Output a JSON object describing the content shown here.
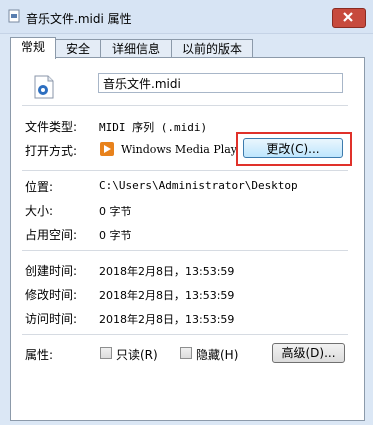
{
  "window": {
    "title": "音乐文件.midi 属性"
  },
  "tabs": [
    {
      "label": "常规",
      "active": true
    },
    {
      "label": "安全"
    },
    {
      "label": "详细信息"
    },
    {
      "label": "以前的版本"
    }
  ],
  "general": {
    "file_name": "音乐文件.midi",
    "file_type_label": "文件类型:",
    "file_type_value": "MIDI 序列 (.midi)",
    "opens_with_label": "打开方式:",
    "opens_with_app": "Windows Media Player",
    "change_button": "更改(C)...",
    "location_label": "位置:",
    "location_value": "C:\\Users\\Administrator\\Desktop",
    "size_label": "大小:",
    "size_value": "0 字节",
    "size_on_disk_label": "占用空间:",
    "size_on_disk_value": "0 字节",
    "created_label": "创建时间:",
    "created_value": "2018年2月8日，13:53:59",
    "modified_label": "修改时间:",
    "modified_value": "2018年2月8日，13:53:59",
    "accessed_label": "访问时间:",
    "accessed_value": "2018年2月8日，13:53:59",
    "attributes_label": "属性:",
    "readonly_label": "只读(R)",
    "hidden_label": "隐藏(H)",
    "advanced_button": "高级(D)..."
  },
  "colors": {
    "highlight_frame": "#e0312a",
    "close_button": "#c74a3d"
  },
  "icons": {
    "title": "file-properties-icon",
    "file": "midi-file-icon",
    "app": "windows-media-player-icon",
    "close": "close-icon"
  }
}
